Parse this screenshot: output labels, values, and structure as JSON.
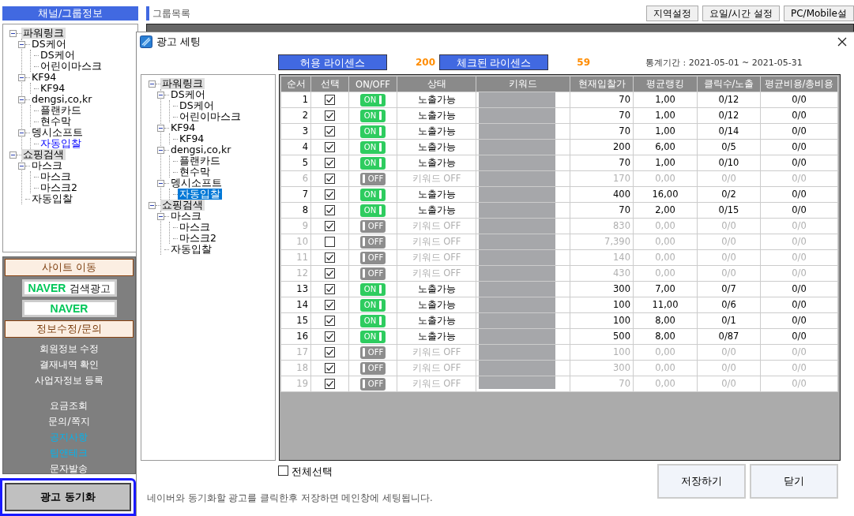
{
  "sidebar": {
    "title": "채널/그룹정보",
    "tree": [
      {
        "label": "파워링크",
        "selected": false,
        "children": [
          {
            "label": "DS케어",
            "selected": false,
            "children": [
              {
                "label": "DS케어",
                "selected": false
              },
              {
                "label": "어린이마스크",
                "selected": false
              }
            ]
          },
          {
            "label": "KF94",
            "selected": false,
            "children": [
              {
                "label": "KF94",
                "selected": false
              }
            ]
          },
          {
            "label": "dengsi,co,kr",
            "selected": false,
            "children": [
              {
                "label": "플랜카드",
                "selected": false
              },
              {
                "label": "현수막",
                "selected": false
              }
            ]
          },
          {
            "label": "뎅시소프트",
            "selected": false,
            "children": [
              {
                "label": "자동입찰",
                "selected": true
              }
            ]
          }
        ]
      },
      {
        "label": "쇼핑검색",
        "selected": false,
        "children": [
          {
            "label": "마스크",
            "selected": false,
            "children": [
              {
                "label": "마스크",
                "selected": false
              },
              {
                "label": "마스크2",
                "selected": false
              }
            ]
          },
          {
            "label": "자동입찰",
            "selected": false
          }
        ]
      }
    ],
    "site_header": "사이트 이동",
    "site_links": [
      {
        "brand": "NAVER",
        "label": "검색광고"
      },
      {
        "brand": "NAVER"
      }
    ],
    "info_header": "정보수정/문의",
    "menu_groups": [
      [
        {
          "label": "회원정보 수정",
          "color": "#ffffff"
        },
        {
          "label": "결재내역 확인",
          "color": "#ffffff"
        },
        {
          "label": "사업자정보 등록",
          "color": "#ffffff"
        }
      ],
      [
        {
          "label": "요금조회",
          "color": "#ffffff"
        },
        {
          "label": "문의/쪽지",
          "color": "#ffffff"
        },
        {
          "label": "공지사항",
          "color": "#00b4f0"
        },
        {
          "label": "팁앤테크",
          "color": "#00b4f0"
        },
        {
          "label": "문자발송",
          "color": "#ffffff"
        }
      ]
    ],
    "sync_button": "광고 동기화"
  },
  "main": {
    "title": "그룹목록",
    "buttons": [
      "지역설정",
      "요일/시간 설정",
      "PC/Mobile설"
    ]
  },
  "dialog": {
    "title": "광고 세팅",
    "allowed_license": {
      "label": "허용 라이센스",
      "value": "200"
    },
    "checked_license": {
      "label": "체크된 라이센스",
      "value": "59"
    },
    "period": "통계기간 : 2021-05-01 ~ 2021-05-31",
    "tree": [
      {
        "label": "파워링크",
        "selected": false,
        "children": [
          {
            "label": "DS케어",
            "selected": false,
            "children": [
              {
                "label": "DS케어",
                "selected": false
              },
              {
                "label": "어린이마스크",
                "selected": false
              }
            ]
          },
          {
            "label": "KF94",
            "selected": false,
            "children": [
              {
                "label": "KF94",
                "selected": false
              }
            ]
          },
          {
            "label": "dengsi,co,kr",
            "selected": false,
            "children": [
              {
                "label": "플랜카드",
                "selected": false
              },
              {
                "label": "현수막",
                "selected": false
              }
            ]
          },
          {
            "label": "뎅시소프트",
            "selected": false,
            "children": [
              {
                "label": "자동입찰",
                "selected": true
              }
            ]
          }
        ]
      },
      {
        "label": "쇼핑검색",
        "selected": false,
        "children": [
          {
            "label": "마스크",
            "selected": false,
            "children": [
              {
                "label": "마스크",
                "selected": false
              },
              {
                "label": "마스크2",
                "selected": false
              }
            ]
          },
          {
            "label": "자동입찰",
            "selected": false
          }
        ]
      }
    ],
    "table": {
      "columns": [
        "순서",
        "선택",
        "ON/OFF",
        "상태",
        "키워드",
        "현재입찰가",
        "평균랭킹",
        "클릭수/노출",
        "평균비용/총비용"
      ],
      "rows": [
        {
          "no": "1",
          "checked": true,
          "on": true,
          "on_label": "ON",
          "status": "노출가능",
          "bid": "70",
          "rank": "1,00",
          "clicks": "0/12",
          "cost": "0/0"
        },
        {
          "no": "2",
          "checked": true,
          "on": true,
          "on_label": "ON",
          "status": "노출가능",
          "bid": "70",
          "rank": "1,00",
          "clicks": "0/12",
          "cost": "0/0"
        },
        {
          "no": "3",
          "checked": true,
          "on": true,
          "on_label": "ON",
          "status": "노출가능",
          "bid": "70",
          "rank": "1,00",
          "clicks": "0/14",
          "cost": "0/0"
        },
        {
          "no": "4",
          "checked": true,
          "on": true,
          "on_label": "ON",
          "status": "노출가능",
          "bid": "200",
          "rank": "6,00",
          "clicks": "0/5",
          "cost": "0/0"
        },
        {
          "no": "5",
          "checked": true,
          "on": true,
          "on_label": "ON",
          "status": "노출가능",
          "bid": "70",
          "rank": "1,00",
          "clicks": "0/10",
          "cost": "0/0"
        },
        {
          "no": "6",
          "checked": true,
          "on": false,
          "on_label": "OFF",
          "status": "키워드 OFF",
          "bid": "170",
          "rank": "0,00",
          "clicks": "0/0",
          "cost": "0/0"
        },
        {
          "no": "7",
          "checked": true,
          "on": true,
          "on_label": "ON",
          "status": "노출가능",
          "bid": "400",
          "rank": "16,00",
          "clicks": "0/2",
          "cost": "0/0"
        },
        {
          "no": "8",
          "checked": true,
          "on": true,
          "on_label": "ON",
          "status": "노출가능",
          "bid": "70",
          "rank": "2,00",
          "clicks": "0/15",
          "cost": "0/0"
        },
        {
          "no": "9",
          "checked": true,
          "on": false,
          "on_label": "OFF",
          "status": "키워드 OFF",
          "bid": "830",
          "rank": "0,00",
          "clicks": "0/0",
          "cost": "0/0"
        },
        {
          "no": "10",
          "checked": false,
          "on": false,
          "on_label": "OFF",
          "status": "키워드 OFF",
          "bid": "7,390",
          "rank": "0,00",
          "clicks": "0/0",
          "cost": "0/0"
        },
        {
          "no": "11",
          "checked": true,
          "on": false,
          "on_label": "OFF",
          "status": "키워드 OFF",
          "bid": "140",
          "rank": "0,00",
          "clicks": "0/0",
          "cost": "0/0"
        },
        {
          "no": "12",
          "checked": true,
          "on": false,
          "on_label": "OFF",
          "status": "키워드 OFF",
          "bid": "430",
          "rank": "0,00",
          "clicks": "0/0",
          "cost": "0/0"
        },
        {
          "no": "13",
          "checked": true,
          "on": true,
          "on_label": "ON",
          "status": "노출가능",
          "bid": "300",
          "rank": "7,00",
          "clicks": "0/7",
          "cost": "0/0"
        },
        {
          "no": "14",
          "checked": true,
          "on": true,
          "on_label": "ON",
          "status": "노출가능",
          "bid": "100",
          "rank": "11,00",
          "clicks": "0/6",
          "cost": "0/0"
        },
        {
          "no": "15",
          "checked": true,
          "on": true,
          "on_label": "ON",
          "status": "노출가능",
          "bid": "100",
          "rank": "8,00",
          "clicks": "0/1",
          "cost": "0/0"
        },
        {
          "no": "16",
          "checked": true,
          "on": true,
          "on_label": "ON",
          "status": "노출가능",
          "bid": "500",
          "rank": "8,00",
          "clicks": "0/87",
          "cost": "0/0"
        },
        {
          "no": "17",
          "checked": true,
          "on": false,
          "on_label": "OFF",
          "status": "키워드 OFF",
          "bid": "100",
          "rank": "0,00",
          "clicks": "0/0",
          "cost": "0/0"
        },
        {
          "no": "18",
          "checked": true,
          "on": false,
          "on_label": "OFF",
          "status": "키워드 OFF",
          "bid": "300",
          "rank": "0,00",
          "clicks": "0/0",
          "cost": "0/0"
        },
        {
          "no": "19",
          "checked": true,
          "on": false,
          "on_label": "OFF",
          "status": "키워드 OFF",
          "bid": "70",
          "rank": "0,00",
          "clicks": "0/0",
          "cost": "0/0"
        }
      ]
    },
    "select_all": {
      "label": "전체선택",
      "checked": false
    },
    "buttons": [
      "저장하기",
      "닫기"
    ],
    "footer": "네이버와 동기화할 광고를 클릭한후 저장하면 메인창에 세팅됩니다."
  }
}
